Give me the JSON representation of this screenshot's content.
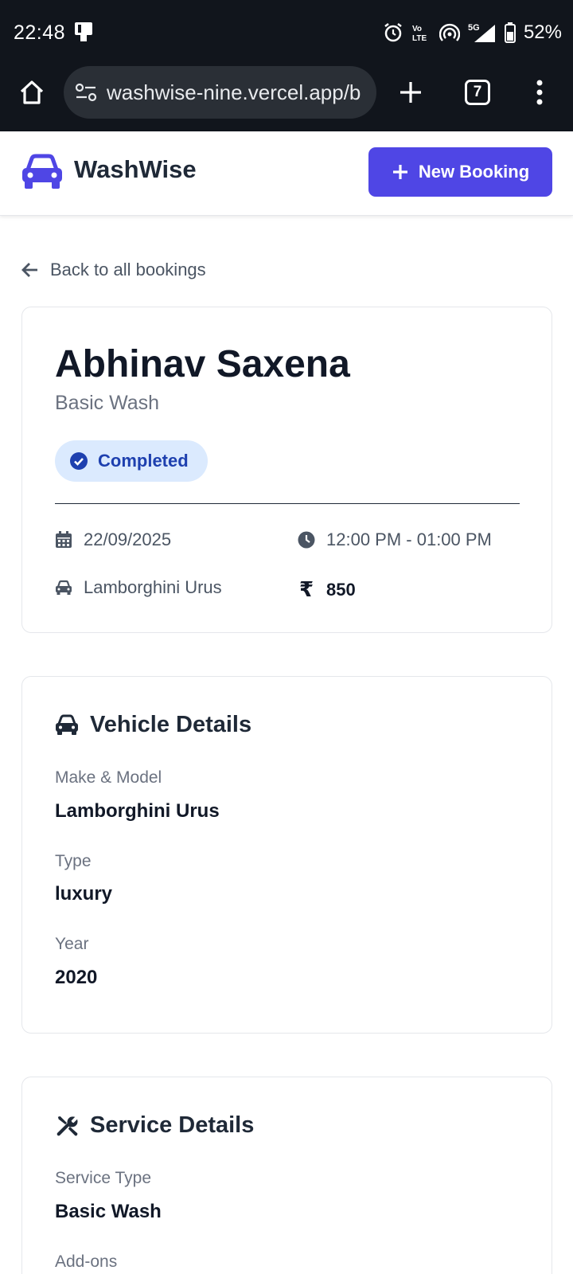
{
  "status_bar": {
    "time": "22:48",
    "battery": "52%",
    "network": "5G",
    "volte": "Vo LTE",
    "icons": [
      "notification-icon",
      "alarm-icon",
      "volte-icon",
      "hotspot-icon",
      "signal-icon",
      "battery-icon"
    ]
  },
  "browser": {
    "url": "washwise-nine.vercel.app/b",
    "tab_count": "7"
  },
  "header": {
    "brand": "WashWise",
    "new_booking_label": "New Booking",
    "accent_color": "#4f46e5"
  },
  "back_link": "Back to all bookings",
  "booking": {
    "customer_name": "Abhinav Saxena",
    "service": "Basic Wash",
    "status": "Completed",
    "date": "22/09/2025",
    "time_slot": "12:00 PM - 01:00 PM",
    "vehicle": "Lamborghini Urus",
    "currency_symbol": "₹",
    "price": "850"
  },
  "vehicle_details": {
    "title": "Vehicle Details",
    "make_model_label": "Make & Model",
    "make_model": "Lamborghini Urus",
    "type_label": "Type",
    "type": "luxury",
    "year_label": "Year",
    "year": "2020"
  },
  "service_details": {
    "title": "Service Details",
    "service_type_label": "Service Type",
    "service_type": "Basic Wash",
    "addons_label": "Add-ons"
  }
}
